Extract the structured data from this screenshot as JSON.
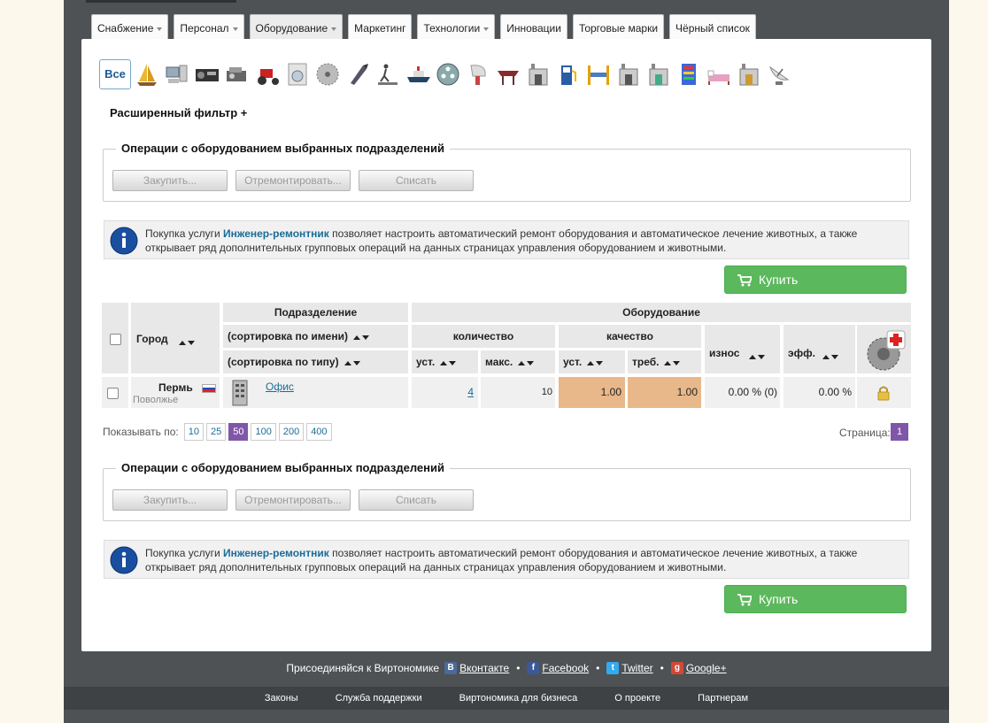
{
  "tabs": [
    {
      "label": "Снабжение",
      "caret": true
    },
    {
      "label": "Персонал",
      "caret": true
    },
    {
      "label": "Оборудование",
      "caret": true,
      "active": true
    },
    {
      "label": "Маркетинг",
      "caret": false
    },
    {
      "label": "Технологии",
      "caret": true
    },
    {
      "label": "Инновации",
      "caret": false
    },
    {
      "label": "Торговые марки",
      "caret": false
    },
    {
      "label": "Чёрный список",
      "caret": false
    }
  ],
  "icon_filter": {
    "all_label": "Все",
    "categories": [
      "sailboat-icon",
      "computer-icon",
      "radio-icon",
      "generator-icon",
      "tractor-icon",
      "washing-machine-icon",
      "saw-blade-icon",
      "drill-icon",
      "treadmill-icon",
      "ship-icon",
      "film-reel-icon",
      "hair-dryer-icon",
      "table-icon",
      "factory-icon",
      "fuel-pump-icon",
      "car-lift-icon",
      "factory-icon",
      "factory-icon",
      "server-rack-icon",
      "bed-icon",
      "factory-icon",
      "satellite-dish-icon"
    ]
  },
  "advanced_filter": "Расширенный фильтр +",
  "operations": {
    "legend": "Операции с оборудованием выбранных подразделений",
    "buttons": [
      "Закупить...",
      "Отремонтировать...",
      "Списать"
    ]
  },
  "notice": {
    "prefix": "Покупка услуги ",
    "service": "Инженер-ремонтник",
    "suffix": " позволяет настроить автоматический ремонт оборудования и автоматическое лечение животных, а также открывает ряд дополнительных групповых операций на данных страницах управления оборудованием и животными."
  },
  "buy_label": "Купить",
  "table": {
    "h_city": "Город",
    "h_division": "Подразделение",
    "h_equipment": "Оборудование",
    "h_sort_name": "(сортировка по имени)",
    "h_sort_type": "(сортировка по типу)",
    "h_quantity": "количество",
    "h_quality": "качество",
    "h_installed": "уст.",
    "h_max": "макс.",
    "h_q_installed": "уст.",
    "h_required": "треб.",
    "h_wear": "износ",
    "h_eff": "эфф.",
    "row": {
      "city": "Пермь",
      "region": "Поволжье",
      "flag": "Russia",
      "division": "Офис",
      "qty_installed": "4",
      "qty_max": "10",
      "quality_installed": "1.00",
      "quality_required": "1.00",
      "wear": "0.00 % (0)",
      "eff": "0.00 %"
    }
  },
  "pager": {
    "show_label": "Показывать по:",
    "sizes": [
      "10",
      "25",
      "50",
      "100",
      "200",
      "400"
    ],
    "active_size": "50",
    "page_label": "Страница:",
    "page": "1"
  },
  "social": {
    "join_label": "Присоединяйся к Виртономике",
    "links": [
      "Вконтакте",
      "Facebook",
      "Twitter",
      "Google+"
    ]
  },
  "footer": [
    "Законы",
    "Служба поддержки",
    "Виртономика для бизнеса",
    "О проекте",
    "Партнерам"
  ]
}
